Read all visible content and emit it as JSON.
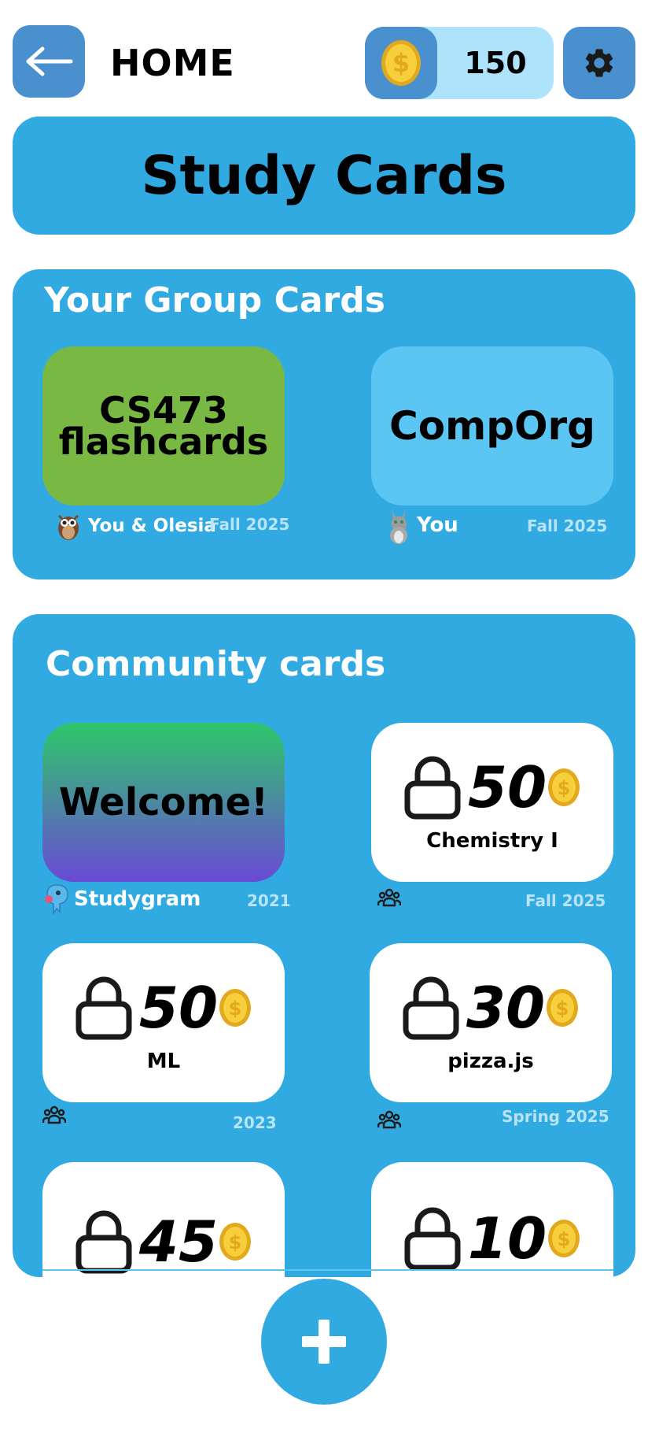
{
  "header": {
    "title": "HOME",
    "coins": "150"
  },
  "banner": {
    "title": "Study Cards"
  },
  "group": {
    "title": "Your Group Cards",
    "cards": [
      {
        "line1": "CS473",
        "line2": "flashcards",
        "owner": "You & Olesia",
        "term": "Fall 2025"
      },
      {
        "title": "CompOrg",
        "owner": "You",
        "term": "Fall 2025"
      }
    ]
  },
  "community": {
    "title": "Community cards",
    "cards": [
      {
        "title": "Welcome!",
        "owner": "Studygram",
        "term": "2021"
      },
      {
        "price": "50",
        "name": "Chemistry I",
        "term": "Fall 2025"
      },
      {
        "price": "50",
        "name": "ML",
        "term": "2023"
      },
      {
        "price": "30",
        "name": "pizza.js",
        "term": "Spring 2025"
      },
      {
        "price": "45"
      },
      {
        "price": "10"
      }
    ]
  },
  "colors": {
    "panel": "#31aae2",
    "button": "#4a90cf",
    "coin_pill": "#aee3fb",
    "card_green": "#79b843",
    "card_light": "#5bc6f3",
    "coin_gold": "#f2c230"
  },
  "icons": [
    "back-arrow-icon",
    "coin-icon",
    "gear-icon",
    "owl-avatar-icon",
    "cat-avatar-icon",
    "mascot-avatar-icon",
    "lock-icon",
    "people-icon",
    "plus-icon"
  ]
}
